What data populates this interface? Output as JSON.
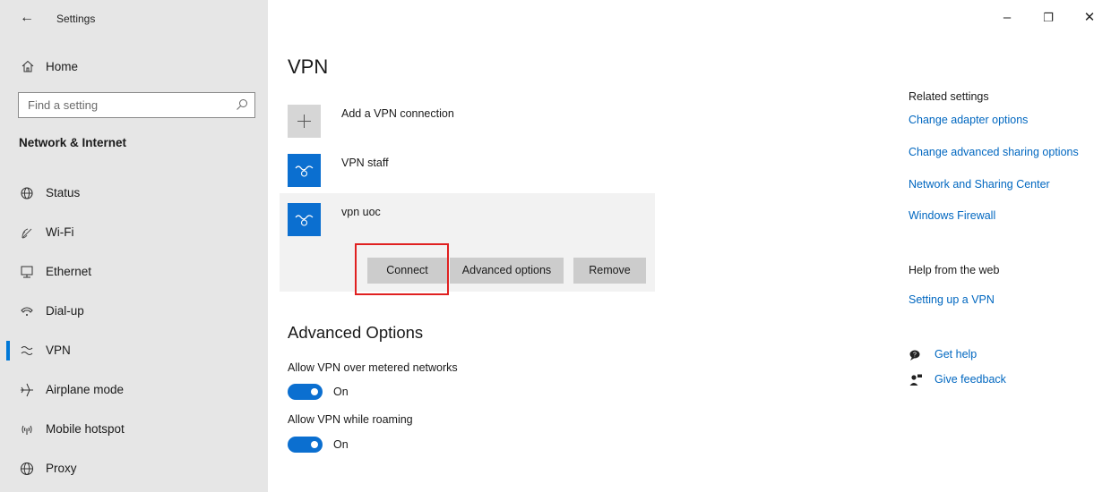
{
  "app": {
    "title": "Settings"
  },
  "window_controls": {
    "minimize": "–",
    "maximize": "❐",
    "close": "✕"
  },
  "sidebar": {
    "home_label": "Home",
    "search_placeholder": "Find a setting",
    "section_title": "Network & Internet",
    "items": [
      {
        "label": "Status",
        "icon": "globe-status-icon"
      },
      {
        "label": "Wi-Fi",
        "icon": "wifi-icon"
      },
      {
        "label": "Ethernet",
        "icon": "ethernet-icon"
      },
      {
        "label": "Dial-up",
        "icon": "dialup-icon"
      },
      {
        "label": "VPN",
        "icon": "vpn-icon",
        "active": true
      },
      {
        "label": "Airplane mode",
        "icon": "airplane-icon"
      },
      {
        "label": "Mobile hotspot",
        "icon": "hotspot-icon"
      },
      {
        "label": "Proxy",
        "icon": "globe-icon"
      }
    ]
  },
  "main": {
    "title": "VPN",
    "add_connection": "Add a VPN connection",
    "connections": [
      {
        "name": "VPN staff"
      },
      {
        "name": "vpn uoc",
        "selected": true
      }
    ],
    "buttons": {
      "connect": "Connect",
      "advanced": "Advanced options",
      "remove": "Remove"
    },
    "advanced": {
      "heading": "Advanced Options",
      "metered_label": "Allow VPN over metered networks",
      "metered_state": "On",
      "roaming_label": "Allow VPN while roaming",
      "roaming_state": "On"
    }
  },
  "related": {
    "heading": "Related settings",
    "links": [
      "Change adapter options",
      "Change advanced sharing options",
      "Network and Sharing Center",
      "Windows Firewall"
    ],
    "web_heading": "Help from the web",
    "web_link": "Setting up a VPN",
    "get_help": "Get help",
    "give_feedback": "Give feedback"
  },
  "colors": {
    "accent": "#0078d7",
    "sidebar_bg": "#e6e6e6",
    "button_bg": "#cccccc",
    "link": "#0067c0",
    "highlight": "#e02020"
  }
}
